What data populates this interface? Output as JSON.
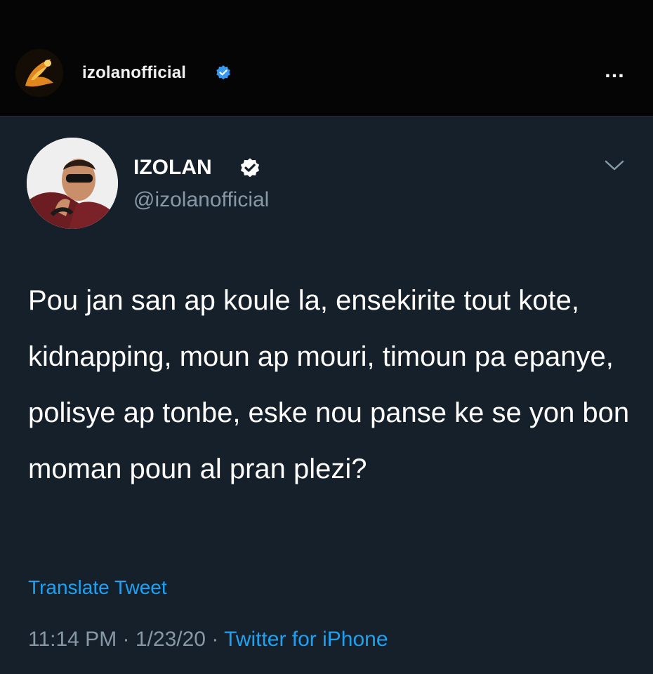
{
  "instagram": {
    "username": "izolanofficial",
    "more_icon": "…"
  },
  "tweet": {
    "display_name": "IZOLAN",
    "handle": "@izolanofficial",
    "text": "Pou jan san ap koule la, ensekirite tout kote, kidnapping, moun ap mouri, timoun pa epanye, polisye ap tonbe, eske nou panse ke se yon bon moman poun al pran plezi?",
    "translate_label": "Translate Tweet",
    "time": "11:14 PM",
    "date": "1/23/20",
    "separator": "·",
    "source": "Twitter for iPhone"
  },
  "colors": {
    "tweet_background": "#15202b",
    "link_blue": "#1da1f2",
    "secondary_text": "#8899a6"
  }
}
